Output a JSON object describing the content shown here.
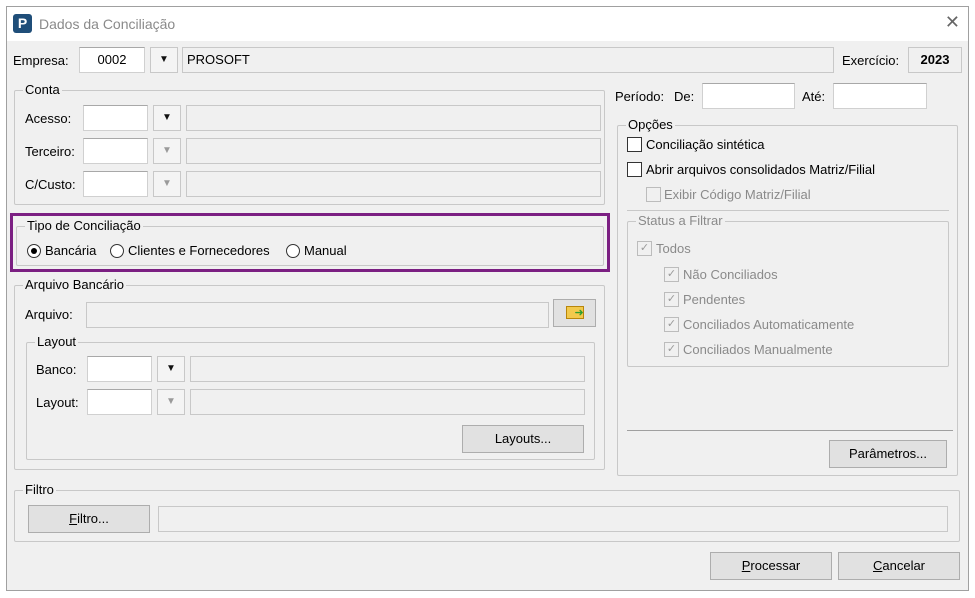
{
  "window": {
    "title": "Dados da Conciliação",
    "logo": "P",
    "close_icon": "✕"
  },
  "empresa": {
    "label": "Empresa:",
    "code": "0002",
    "name": "PROSOFT"
  },
  "exercicio": {
    "label": "Exercício:",
    "value": "2023"
  },
  "conta": {
    "title": "Conta",
    "acesso": "Acesso:",
    "terceiro": "Terceiro:",
    "custo": "C/Custo:"
  },
  "periodo": {
    "label": "Período:",
    "de": "De:",
    "ate": "Até:",
    "de_value": "",
    "ate_value": ""
  },
  "tipo": {
    "title": "Tipo de Conciliação",
    "options": [
      "Bancária",
      "Clientes e Fornecedores",
      "Manual"
    ],
    "selected": "Bancária",
    "highlight_color": "#7b1f82"
  },
  "arquivo": {
    "title": "Arquivo Bancário",
    "label": "Arquivo:",
    "folder_icon": "open-folder"
  },
  "layout": {
    "title": "Layout",
    "banco": "Banco:",
    "layout": "Layout:",
    "button": "Layouts..."
  },
  "opcoes": {
    "title": "Opções",
    "sintetica": "Conciliação sintética",
    "consolidados": "Abrir arquivos consolidados Matriz/Filial",
    "exibir": "Exibir Código Matriz/Filial",
    "parametros": "Parâmetros..."
  },
  "status": {
    "title": "Status a Filtrar",
    "todos": "Todos",
    "items": [
      "Não Conciliados",
      "Pendentes",
      "Conciliados Automaticamente",
      "Conciliados Manualmente"
    ]
  },
  "filtro": {
    "title": "Filtro",
    "button_u": "F",
    "button_rest": "iltro...",
    "value": ""
  },
  "footer": {
    "processar_u": "P",
    "processar_rest": "rocessar",
    "cancelar_u": "C",
    "cancelar_rest": "ancelar"
  }
}
